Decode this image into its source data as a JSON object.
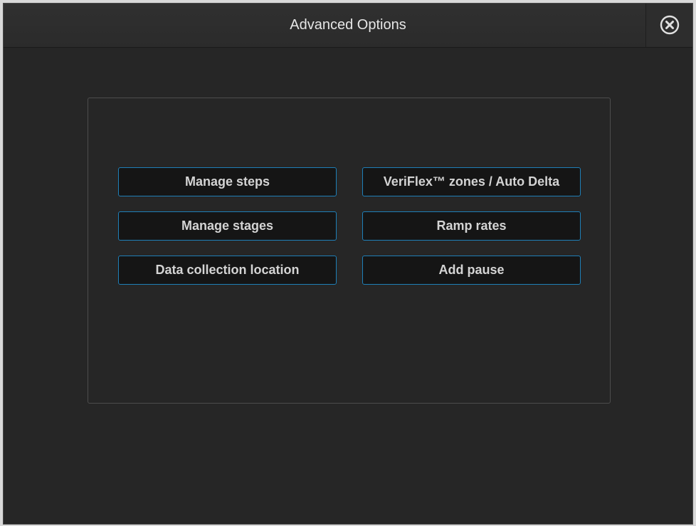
{
  "dialog": {
    "title": "Advanced Options",
    "close_icon": "close-circle-x-icon"
  },
  "options": {
    "manage_steps": "Manage steps",
    "veriflex": "VeriFlex™ zones / Auto Delta",
    "manage_stages": "Manage stages",
    "ramp_rates": "Ramp rates",
    "data_collection": "Data collection location",
    "add_pause": "Add pause"
  },
  "colors": {
    "background": "#262626",
    "button_border": "#1e7fb8",
    "button_fill": "#151515",
    "text": "#d4d4d4"
  }
}
